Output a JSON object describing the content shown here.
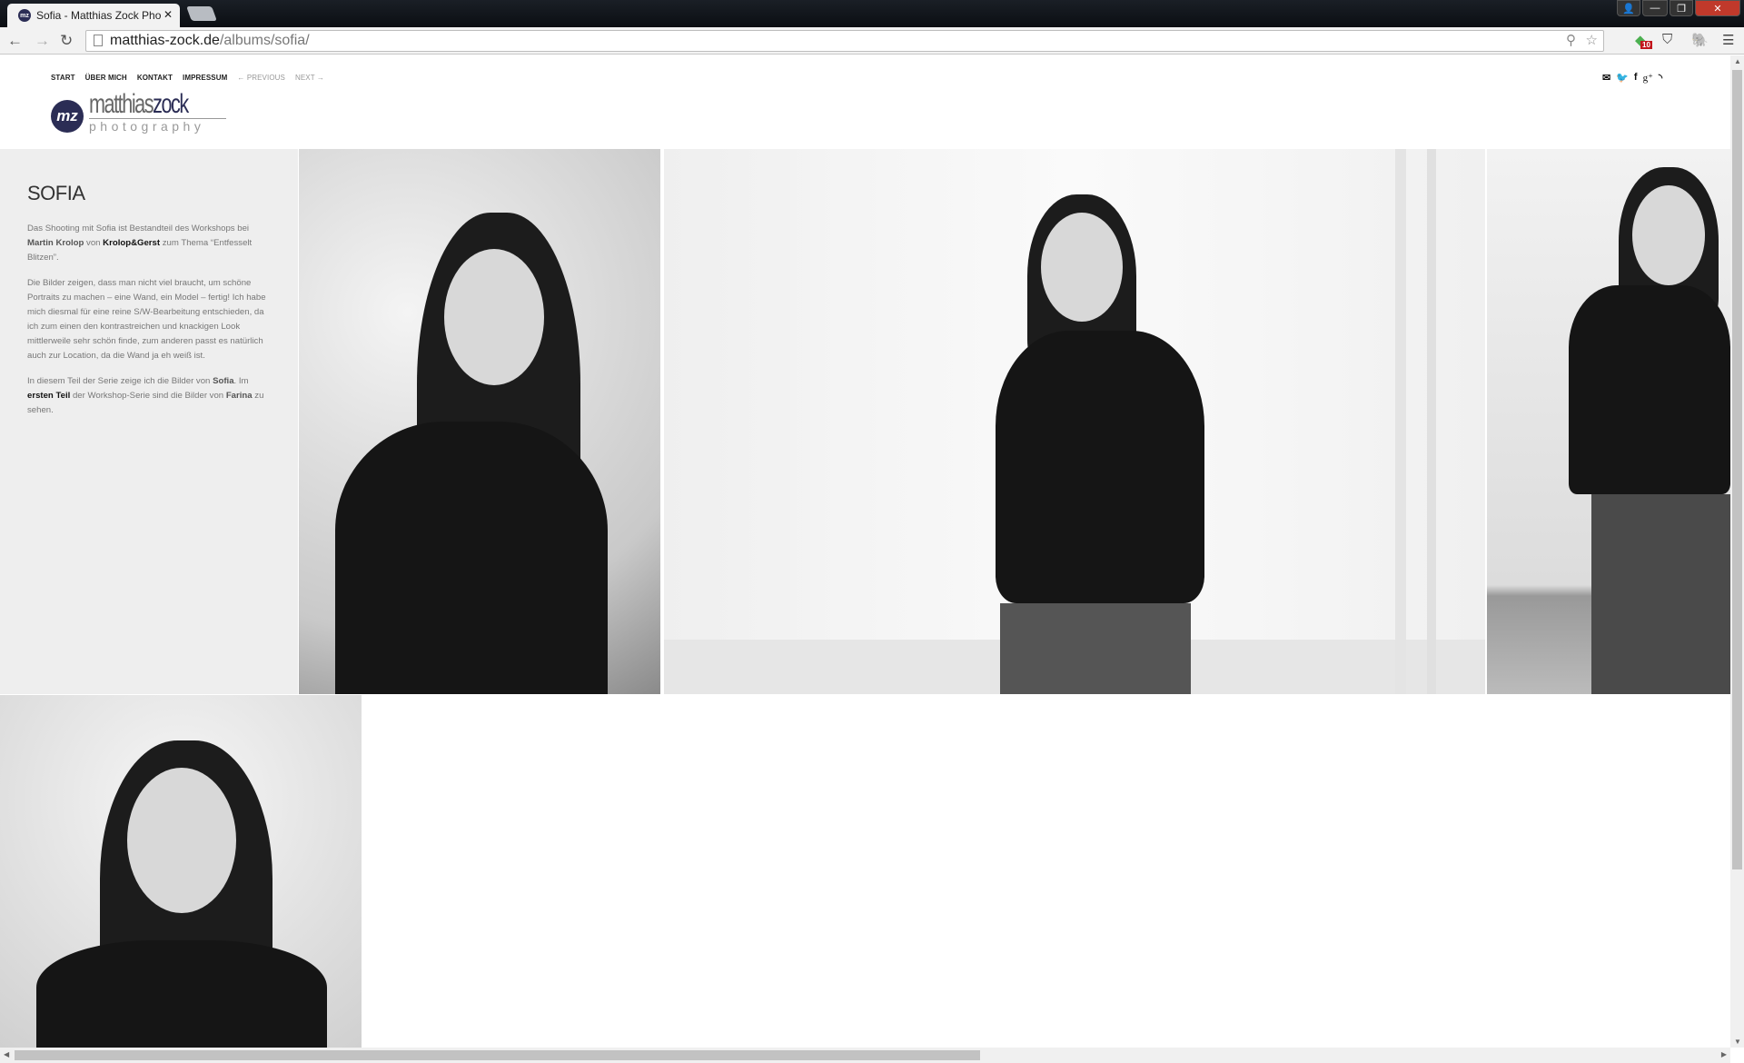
{
  "browser": {
    "tab_title": "Sofia - Matthias Zock Pho",
    "favicon_text": "mz",
    "url_host": "matthias-zock.de",
    "url_path": "/albums/sofia/",
    "extension_badge": "10"
  },
  "nav": {
    "items": [
      "START",
      "ÜBER MICH",
      "KONTAKT",
      "IMPRESSUM"
    ],
    "previous": "← PREVIOUS",
    "next": "NEXT →"
  },
  "logo": {
    "mark": "mz",
    "name_light": "matthias",
    "name_dark": "zock",
    "tagline": "photography"
  },
  "social": [
    "mail-icon",
    "twitter-icon",
    "facebook-icon",
    "google-plus-icon",
    "rss-icon"
  ],
  "album": {
    "title": "SOFIA",
    "p1": {
      "a": "Das Shooting mit Sofia ist Bestandteil des Workshops bei ",
      "b1": "Martin Krolop",
      "c": " von ",
      "b2": "Krolop&Gerst",
      "d": " zum Thema “Entfesselt Blitzen”."
    },
    "p2": "Die Bilder zeigen, dass man nicht viel braucht, um schöne Portraits zu machen – eine Wand, ein Model – fertig! Ich habe mich diesmal für eine reine S/W-Bearbeitung entschieden, da ich zum einen den kontrastreichen und knackigen Look mittlerweile sehr schön finde, zum anderen passt es natürlich auch zur Location, da die Wand ja eh weiß ist.",
    "p3": {
      "a": "In diesem Teil der Serie zeige ich die Bilder von ",
      "b1": "Sofia",
      "c": ". Im ",
      "b2": "ersten Teil",
      "d": " der Workshop-Serie sind die Bilder von ",
      "b3": "Farina",
      "e": " zu sehen."
    }
  },
  "colors": {
    "brand": "#2b2d55",
    "sidebar_bg": "#eeeeee"
  }
}
